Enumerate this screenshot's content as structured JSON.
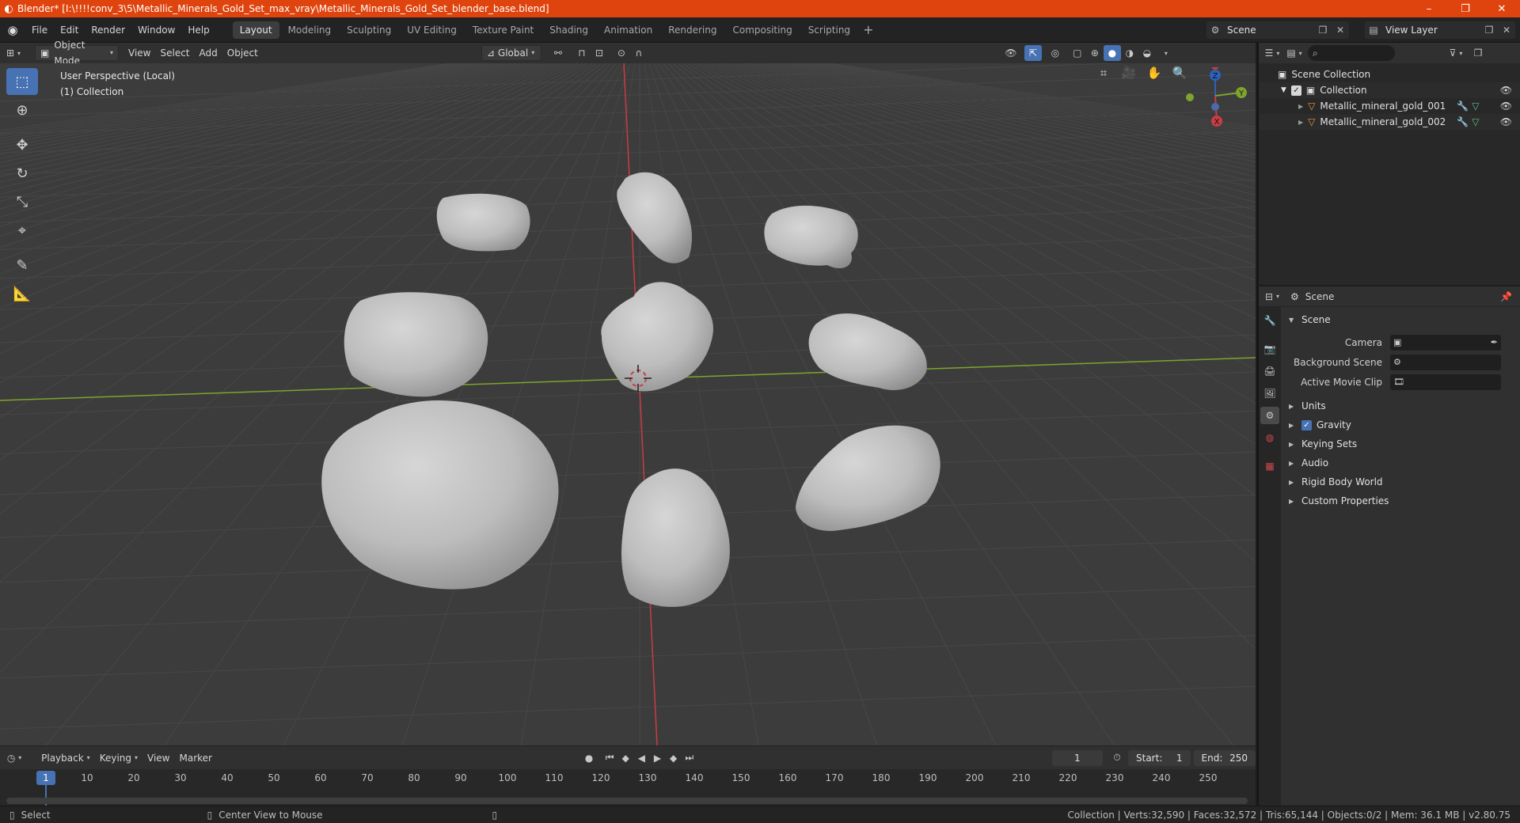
{
  "titlebar": {
    "title": "Blender* [I:\\!!!!conv_3\\5\\Metallic_Minerals_Gold_Set_max_vray\\Metallic_Minerals_Gold_Set_blender_base.blend]",
    "minimize": "–",
    "maximize": "❐",
    "close": "✕"
  },
  "menu": [
    "File",
    "Edit",
    "Render",
    "Window",
    "Help"
  ],
  "workspaces": [
    {
      "label": "Layout",
      "active": true
    },
    {
      "label": "Modeling"
    },
    {
      "label": "Sculpting"
    },
    {
      "label": "UV Editing"
    },
    {
      "label": "Texture Paint"
    },
    {
      "label": "Shading"
    },
    {
      "label": "Animation"
    },
    {
      "label": "Rendering"
    },
    {
      "label": "Compositing"
    },
    {
      "label": "Scripting"
    }
  ],
  "scene_selector": {
    "value": "Scene"
  },
  "viewlayer_selector": {
    "value": "View Layer"
  },
  "viewport_header": {
    "mode": "Object Mode",
    "view": "View",
    "select": "Select",
    "add": "Add",
    "object": "Object",
    "transform_orientation": "Global"
  },
  "viewport": {
    "perspective_label": "User Perspective (Local)",
    "collection_label": "(1) Collection",
    "axes": {
      "x": "X",
      "y": "Y",
      "z": "Z"
    }
  },
  "timeline": {
    "playback": "Playback",
    "keying": "Keying",
    "view": "View",
    "marker": "Marker",
    "current_frame": "1",
    "start_label": "Start:",
    "start": "1",
    "end_label": "End:",
    "end": "250",
    "ticks": [
      "10",
      "20",
      "30",
      "40",
      "50",
      "60",
      "70",
      "80",
      "90",
      "100",
      "110",
      "120",
      "130",
      "140",
      "150",
      "160",
      "170",
      "180",
      "190",
      "200",
      "210",
      "220",
      "230",
      "240",
      "250"
    ],
    "marker_frame": "1"
  },
  "statusbar": {
    "select": "Select",
    "center_view": "Center View to Mouse",
    "stats": "Collection | Verts:32,590 | Faces:32,572 | Tris:65,144 | Objects:0/2 | Mem: 36.1 MB | v2.80.75"
  },
  "outliner": {
    "scene_collection": "Scene Collection",
    "collection": "Collection",
    "objects": [
      "Metallic_mineral_gold_001",
      "Metallic_mineral_gold_002"
    ]
  },
  "properties": {
    "header": "Scene",
    "panel_scene": "Scene",
    "camera_label": "Camera",
    "background_scene_label": "Background Scene",
    "active_clip_label": "Active Movie Clip",
    "panels": [
      "Units",
      "Gravity",
      "Keying Sets",
      "Audio",
      "Rigid Body World",
      "Custom Properties"
    ]
  },
  "colors": {
    "titlebar": "#e0440e",
    "accent": "#4772b3",
    "viewport_bg": "#3c3c3c",
    "x_axis": "#c83d45",
    "y_axis": "#7ea42e"
  }
}
